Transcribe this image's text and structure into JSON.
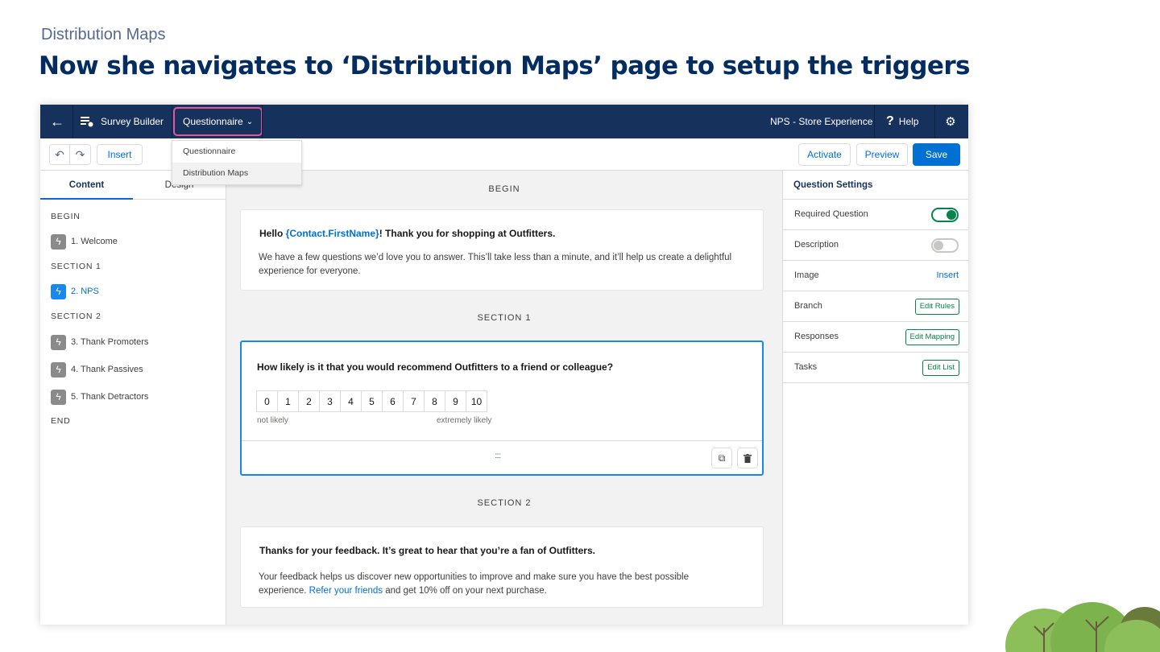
{
  "slide": {
    "kicker": "Distribution Maps",
    "title": "Now she navigates to ‘Distribution Maps’ page to setup the triggers"
  },
  "topbar": {
    "back_icon": "arrow-left-icon",
    "builder_label": "Survey Builder",
    "page_select": "Questionnaire",
    "survey_name": "NPS - Store Experience",
    "help_label": "Help"
  },
  "toolbar": {
    "insert_label": "Insert",
    "activate_label": "Activate",
    "preview_label": "Preview",
    "save_label": "Save"
  },
  "dropdown": {
    "options": [
      "Questionnaire",
      "Distribution Maps"
    ]
  },
  "left_panel": {
    "tabs": [
      "Content",
      "Design"
    ],
    "outline": {
      "begin": "BEGIN",
      "item1": "1. Welcome",
      "section1": "SECTION 1",
      "item2": "2. NPS",
      "section2": "SECTION 2",
      "item3": "3. Thank Promoters",
      "item4": "4. Thank Passives",
      "item5": "5. Thank Detractors",
      "end": "END"
    }
  },
  "canvas": {
    "begin_label": "BEGIN",
    "welcome": {
      "title_pre": "Hello ",
      "title_merge": "{Contact.FirstName}",
      "title_post": "!  Thank you for shopping at Outfitters.",
      "body": "We have a few questions we’d love you to answer. This’ll take less than a minute, and it’ll help us create a delightful experience for everyone."
    },
    "section1_label": "SECTION 1",
    "nps": {
      "question": "How likely is it that you would recommend Outfitters to a friend or colleague?",
      "scale": [
        "0",
        "1",
        "2",
        "3",
        "4",
        "5",
        "6",
        "7",
        "8",
        "9",
        "10"
      ],
      "low_label": "not likely",
      "high_label": "extremely likely",
      "drag_handle": "::::"
    },
    "section2_label": "SECTION 2",
    "thanks": {
      "title": "Thanks for your feedback. It’s great to hear that you’re a fan of Outfitters.",
      "body_pre": "Your feedback helps us discover new opportunities to improve and make sure you have the best possible experience. ",
      "body_link": "Refer your friends",
      "body_post": " and get 10% off on your next purchase."
    }
  },
  "settings": {
    "header": "Question Settings",
    "required_label": "Required Question",
    "required_on": true,
    "description_label": "Description",
    "description_on": false,
    "image_label": "Image",
    "image_action": "Insert",
    "branch_label": "Branch",
    "branch_action": "Edit Rules",
    "responses_label": "Responses",
    "responses_action": "Edit Mapping",
    "tasks_label": "Tasks",
    "tasks_action": "Edit List"
  },
  "colors": {
    "nav_bg": "#16325c",
    "brand_blue": "#0070d2",
    "highlight_pink": "#e3579a",
    "toggle_green": "#04844b",
    "title_navy": "#032d60"
  }
}
